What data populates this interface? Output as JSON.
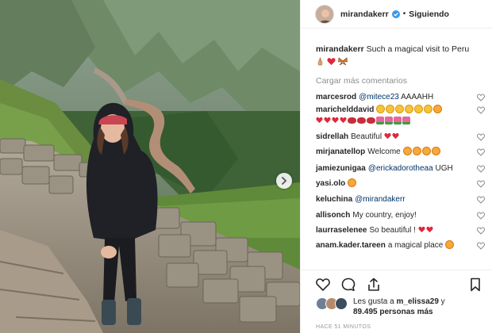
{
  "post": {
    "username": "mirandakerr",
    "follow_label": "Siguiendo",
    "separator": "•",
    "caption_user": "mirandakerr",
    "caption_text": "Such a magical visit to Peru",
    "load_more": "Cargar más comentarios"
  },
  "comments": [
    {
      "user": "marcesrod",
      "mention": "@mitece23",
      "text": "AAAAHH",
      "emoji": []
    },
    {
      "user": "marichelddavid",
      "mention": "",
      "text": "",
      "emoji": [
        "grin",
        "grin",
        "grin",
        "grin",
        "grin",
        "grin",
        "love",
        "heart",
        "heart",
        "heart",
        "heart",
        "lips",
        "lips",
        "lips",
        "flower",
        "flower",
        "flower",
        "flower"
      ]
    },
    {
      "user": "sidrellah",
      "mention": "",
      "text": "Beautiful",
      "emoji": [
        "heart",
        "heart"
      ]
    },
    {
      "user": "mirjanatellop",
      "mention": "",
      "text": "Welcome",
      "emoji": [
        "love",
        "love",
        "love",
        "love"
      ]
    },
    {
      "user": "jamiezunigaa",
      "mention": "@erickadorotheaa",
      "text": "UGH",
      "emoji": []
    },
    {
      "user": "yasi.olo",
      "mention": "",
      "text": "",
      "emoji": [
        "love"
      ]
    },
    {
      "user": "keluchina",
      "mention": "@mirandakerr",
      "text": "",
      "emoji": []
    },
    {
      "user": "allisonch",
      "mention": "",
      "text": "My country, enjoy!",
      "emoji": []
    },
    {
      "user": "laurraselenee",
      "mention": "",
      "text": "So beautiful !",
      "emoji": [
        "heart",
        "heart"
      ]
    },
    {
      "user": "anam.kader.tareen",
      "mention": "",
      "text": "a magical place",
      "emoji": [
        "love"
      ]
    }
  ],
  "likes": {
    "prefix": "Les gusta a",
    "user": "m_elissa29",
    "connector": "y",
    "count": "89.495 personas más"
  },
  "timestamp": "HACE 51 MINUTOS",
  "colors": {
    "link": "#003569",
    "muted": "#8e8e8e",
    "verified": "#3897f0",
    "heart": "#ed4956"
  }
}
